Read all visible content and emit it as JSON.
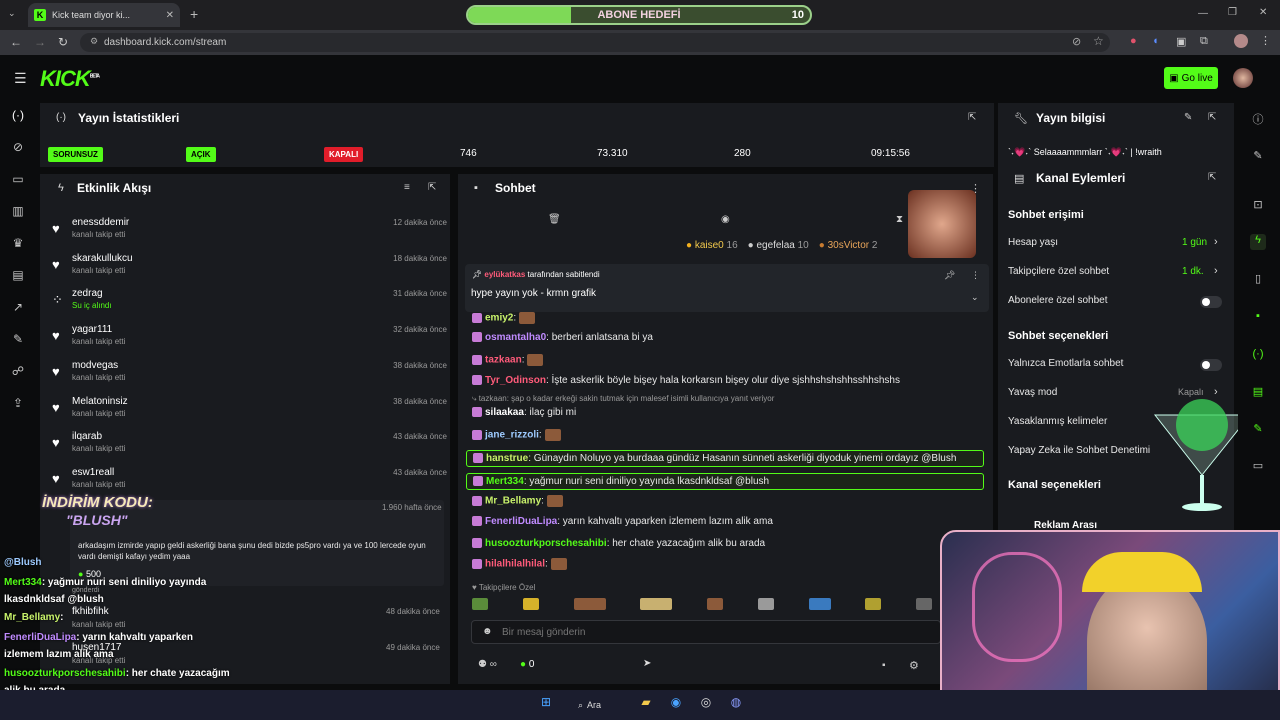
{
  "browser": {
    "tab_title": "Kick team diyor ki...",
    "url": "dashboard.kick.com/stream"
  },
  "overlay": {
    "abone_label": "ABONE HEDEFİ",
    "abone_value": "10",
    "abone_progress": 0.3,
    "promo_title": "İNDİRİM KODU:",
    "promo_code": "\"BLUSH\"",
    "lines": [
      {
        "user": "@Blush",
        "text": "",
        "color": "#9ecbff"
      },
      {
        "user": "Mert334",
        "text": ": yağmur nuri seni diniliyo yayında",
        "color": "#53fc18"
      },
      {
        "user": "",
        "text": "lkasdnkldsaf @blush",
        "color": "#ffffff"
      },
      {
        "user": "Mr_Bellamy",
        "text": ":",
        "color": "#c8f26b"
      },
      {
        "user": "FenerliDuaLipa",
        "text": ": yarın kahvaltı yaparken",
        "color": "#c08bff"
      },
      {
        "user": "",
        "text": "izlemem lazım alik ama",
        "color": "#ffffff"
      },
      {
        "user": "husoozturkporschesahibi",
        "text": ": her chate yazacağım",
        "color": "#53fc18"
      },
      {
        "user": "",
        "text": "alik bu arada",
        "color": "#ffffff"
      },
      {
        "user": "hilalhilalhilal",
        "text": ":",
        "color": "#ff5b7a"
      }
    ]
  },
  "header": {
    "logo": "KICK",
    "beta": "BETA",
    "go_live": "Go live"
  },
  "stats": {
    "title": "Yayın İstatistikleri",
    "badges": [
      "SORUNSUZ",
      "AÇIK",
      "KAPALI"
    ],
    "values": [
      "746",
      "73.310",
      "280",
      "09:15:56"
    ]
  },
  "info": {
    "title": "Yayın bilgisi",
    "stream_title": "`˖💗˖` Selaaaammmlarr `˖💗˖` | !wraith"
  },
  "activity": {
    "title": "Etkinlik Akışı",
    "events": [
      {
        "name": "enessddemir",
        "sub": "kanalı takip etti",
        "time": "12 dakika önce",
        "icon": "♥"
      },
      {
        "name": "skarakullukcu",
        "sub": "kanalı takip etti",
        "time": "18 dakika önce",
        "icon": "♥"
      },
      {
        "name": "zedrag",
        "sub": "Su iç alındı",
        "time": "31 dakika önce",
        "icon": "⁘"
      },
      {
        "name": "yagar111",
        "sub": "kanalı takip etti",
        "time": "32 dakika önce",
        "icon": "♥"
      },
      {
        "name": "modvegas",
        "sub": "kanalı takip etti",
        "time": "38 dakika önce",
        "icon": "♥"
      },
      {
        "name": "Melatoninsiz",
        "sub": "kanalı takip etti",
        "time": "38 dakika önce",
        "icon": "♥"
      },
      {
        "name": "ilqarab",
        "sub": "kanalı takip etti",
        "time": "43 dakika önce",
        "icon": "♥"
      },
      {
        "name": "esw1reall",
        "sub": "kanalı takip etti",
        "time": "43 dakika önce",
        "icon": "♥"
      }
    ],
    "special": {
      "name": "fkhibfihk",
      "sub": "kanalı takip etti",
      "time": "48 dakika önce"
    },
    "special2": {
      "name": "husen1717",
      "sub": "kanalı takip etti",
      "time": "49 dakika önce"
    },
    "big": {
      "time": "1.960 hafta önce",
      "text": "arkadaşım izmirde yapıp geldi askerliği bana şunu dedi bizde ps5pro vardı ya ve 100 lercede oyun vardı demişti kafayı yedim yaaa",
      "amount": "500",
      "sent": "gönderdi"
    }
  },
  "chat": {
    "title": "Sohbet",
    "top_users": [
      {
        "name": "kaise0",
        "count": "16"
      },
      {
        "name": "egefelaa",
        "count": "10"
      },
      {
        "name": "30sVictor",
        "count": "2"
      }
    ],
    "pinned_by": "eylükatkas",
    "pinned_suffix": "tarafından sabitlendi",
    "pinned_text": "hype yayın yok - krmn grafik",
    "messages": [
      {
        "user": "emiy2",
        "text": ":",
        "color": "#c8f26b"
      },
      {
        "user": "osmantalha0",
        "text": ": berberi anlatsana bi ya",
        "color": "#c08bff"
      },
      {
        "user": "tazkaan",
        "text": ":",
        "color": "#ff5b7a"
      },
      {
        "user": "Tyr_Odinson",
        "text": ": İşte askerlik böyle bişey hala korkarsın bişey olur diye sjshhshshshhsshhshshs",
        "color": "#ff5b7a"
      },
      {
        "user": "",
        "text": "⤷ tazkaan: şap o kadar erkeği sakin tutmak için malesef isimli kullanıcıya yanıt veriyor",
        "color": "#9a9a9a"
      },
      {
        "user": "silaakaa",
        "text": ": ilaç gibi mi",
        "color": "#ffffff"
      },
      {
        "user": "jane_rizzoli",
        "text": ":",
        "color": "#9ecbff"
      },
      {
        "user": "hanstrue",
        "text": ": Günaydın Noluyo ya burdaaa gündüz Hasanın sünneti askerliği diyoduk yinemi ordayız @Blush",
        "color": "#c8f26b"
      },
      {
        "user": "Mert334",
        "text": ": yağmur nuri seni diniliyo yayında lkasdnkldsaf @blush",
        "color": "#53fc18"
      },
      {
        "user": "Mr_Bellamy",
        "text": ":",
        "color": "#c8f26b"
      },
      {
        "user": "FenerliDuaLipa",
        "text": ": yarın kahvaltı yaparken izlemem lazım alik ama",
        "color": "#c08bff"
      },
      {
        "user": "husoozturkporschesahibi",
        "text": ": her chate yazacağım alik bu arada",
        "color": "#53fc18"
      },
      {
        "user": "hilalhilalhilal",
        "text": ":",
        "color": "#ff5b7a"
      }
    ],
    "followers_only": "Takipçilere Özel",
    "placeholder": "Bir mesaj gönderin",
    "points": "0"
  },
  "actions": {
    "title": "Kanal Eylemleri",
    "section1": "Sohbet erişimi",
    "rows1": [
      {
        "label": "Hesap yaşı",
        "value": "1 gün"
      },
      {
        "label": "Takipçilere özel sohbet",
        "value": "1 dk."
      },
      {
        "label": "Abonelere özel sohbet",
        "value": ""
      }
    ],
    "section2": "Sohbet seçenekleri",
    "rows2": [
      {
        "label": "Yalnızca Emotlarla sohbet",
        "value": ""
      },
      {
        "label": "Yavaş mod",
        "value": "Kapalı"
      },
      {
        "label": "Yasaklanmış kelimeler",
        "value": ""
      },
      {
        "label": "Yapay Zeka ile Sohbet Denetimi",
        "value": ""
      }
    ],
    "section3": "Kanal seçenekleri",
    "section4": "Reklam Arası"
  },
  "taskbar": {
    "search": "Ara"
  }
}
